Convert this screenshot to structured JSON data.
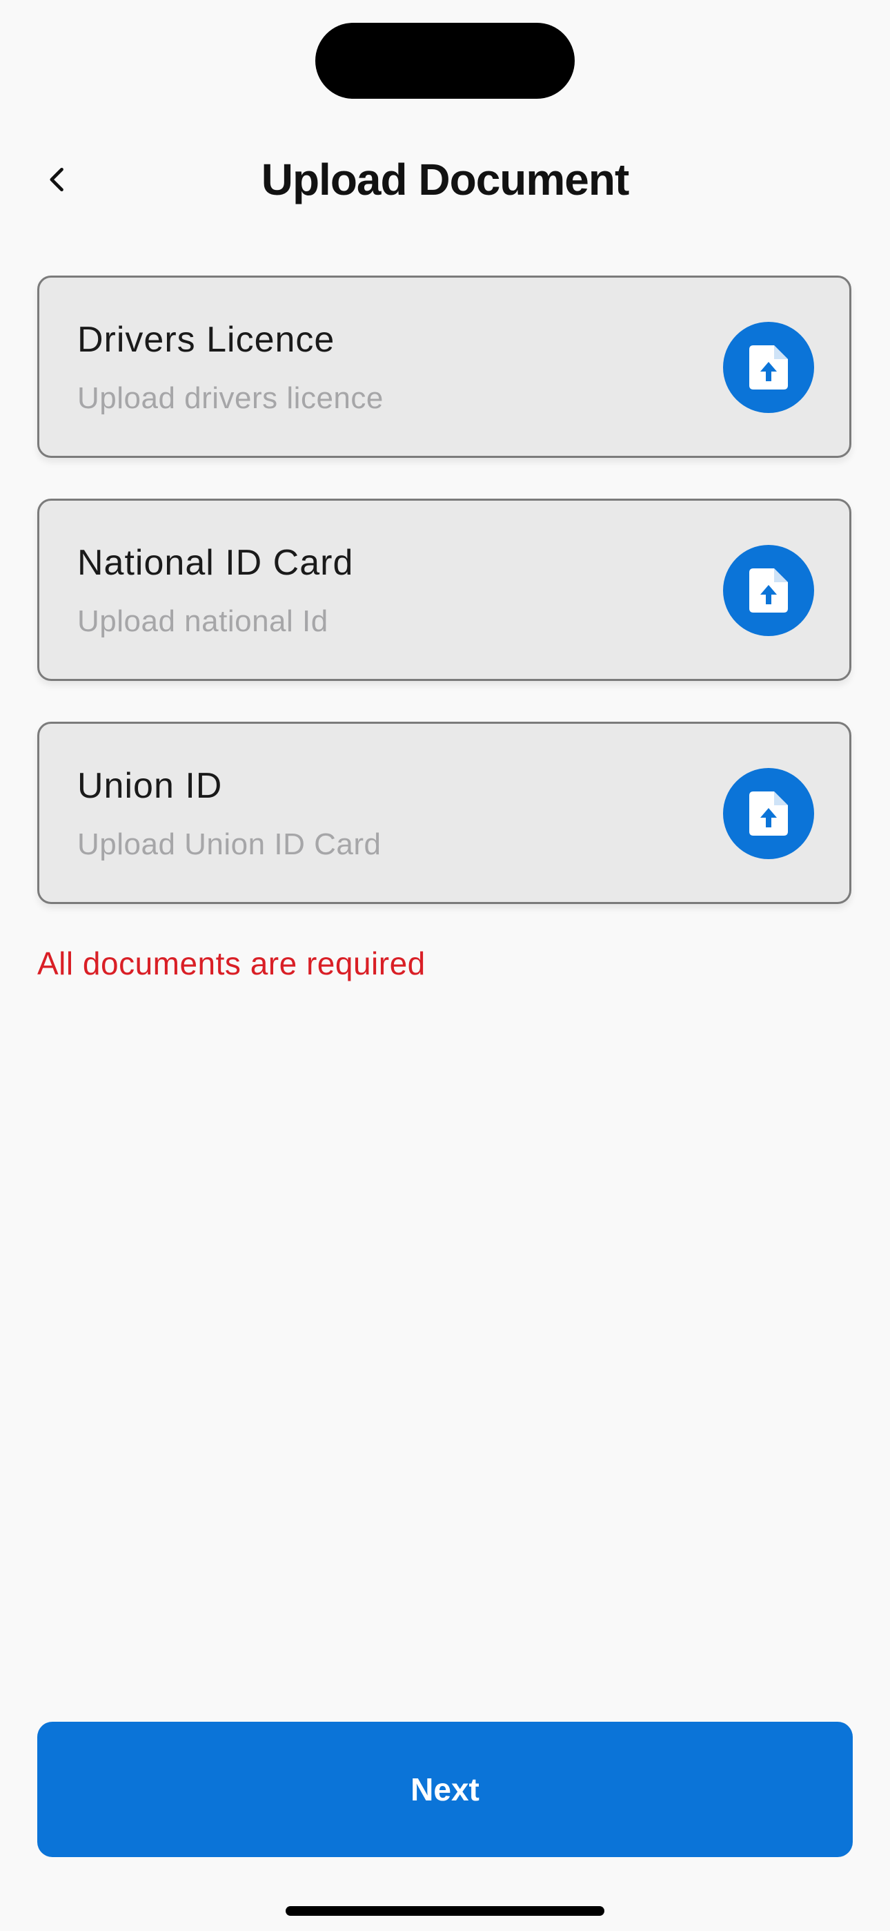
{
  "theme": {
    "accent": "#0b74d8",
    "error": "#d91f26",
    "background": "#f9f9f9",
    "card_background": "#e9e9e9"
  },
  "header": {
    "title": "Upload Document",
    "back_icon": "chevron-left-icon"
  },
  "documents": [
    {
      "title": "Drivers Licence",
      "subtitle": "Upload drivers licence",
      "icon": "file-upload-icon"
    },
    {
      "title": "National ID Card",
      "subtitle": "Upload national Id",
      "icon": "file-upload-icon"
    },
    {
      "title": "Union ID",
      "subtitle": "Upload Union ID Card",
      "icon": "file-upload-icon"
    }
  ],
  "validation": {
    "error_message": "All documents are required"
  },
  "footer": {
    "next_label": "Next"
  }
}
